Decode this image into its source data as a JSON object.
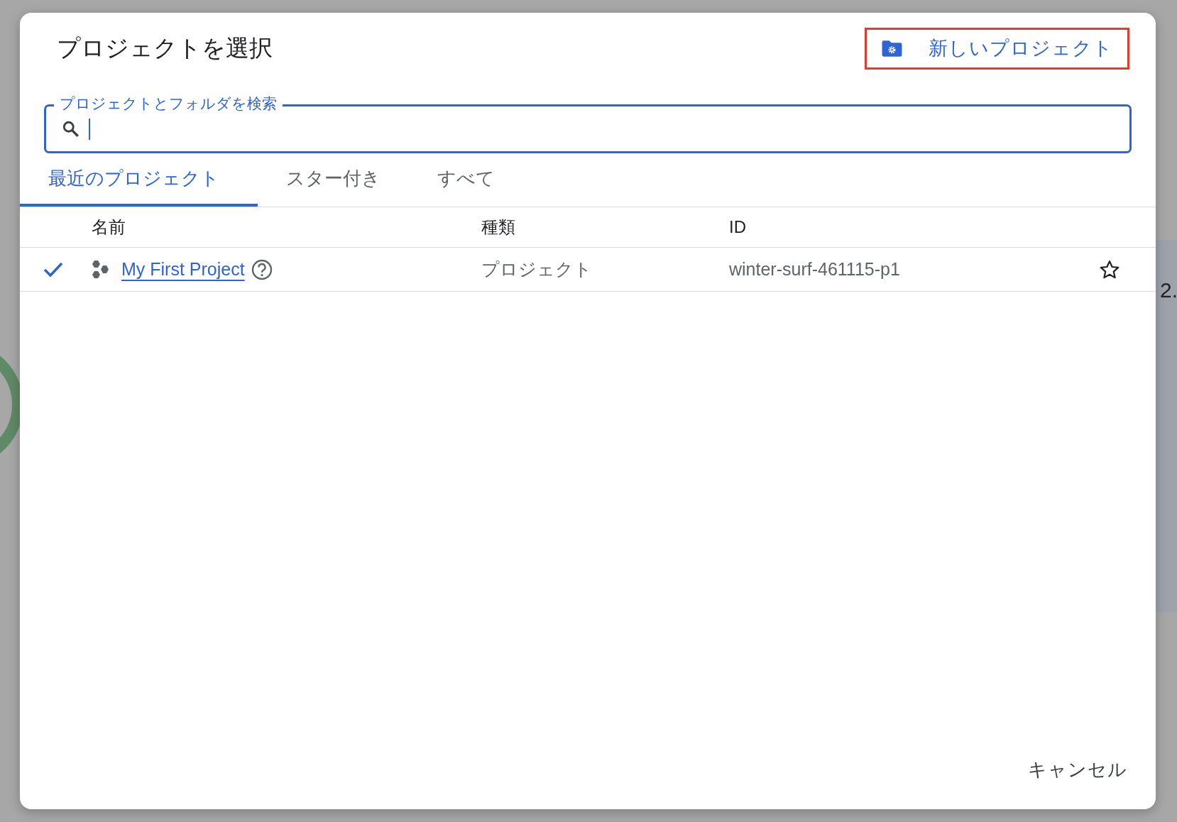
{
  "background": {
    "fragment": "2."
  },
  "dialog": {
    "title": "プロジェクトを選択",
    "new_project_button": "新しいプロジェクト",
    "search": {
      "label": "プロジェクトとフォルダを検索",
      "focused": true
    },
    "tabs": [
      {
        "label": "最近のプロジェクト",
        "selected": true
      },
      {
        "label": "スター付き",
        "selected": false
      },
      {
        "label": "すべて",
        "selected": false
      }
    ],
    "table": {
      "columns": [
        "名前",
        "種類",
        "ID"
      ],
      "rows": [
        {
          "selected": true,
          "name": "My First Project",
          "type": "プロジェクト",
          "id": "winter-surf-461115-p1",
          "starred": false
        }
      ]
    },
    "cancel_button": "キャンセル"
  }
}
